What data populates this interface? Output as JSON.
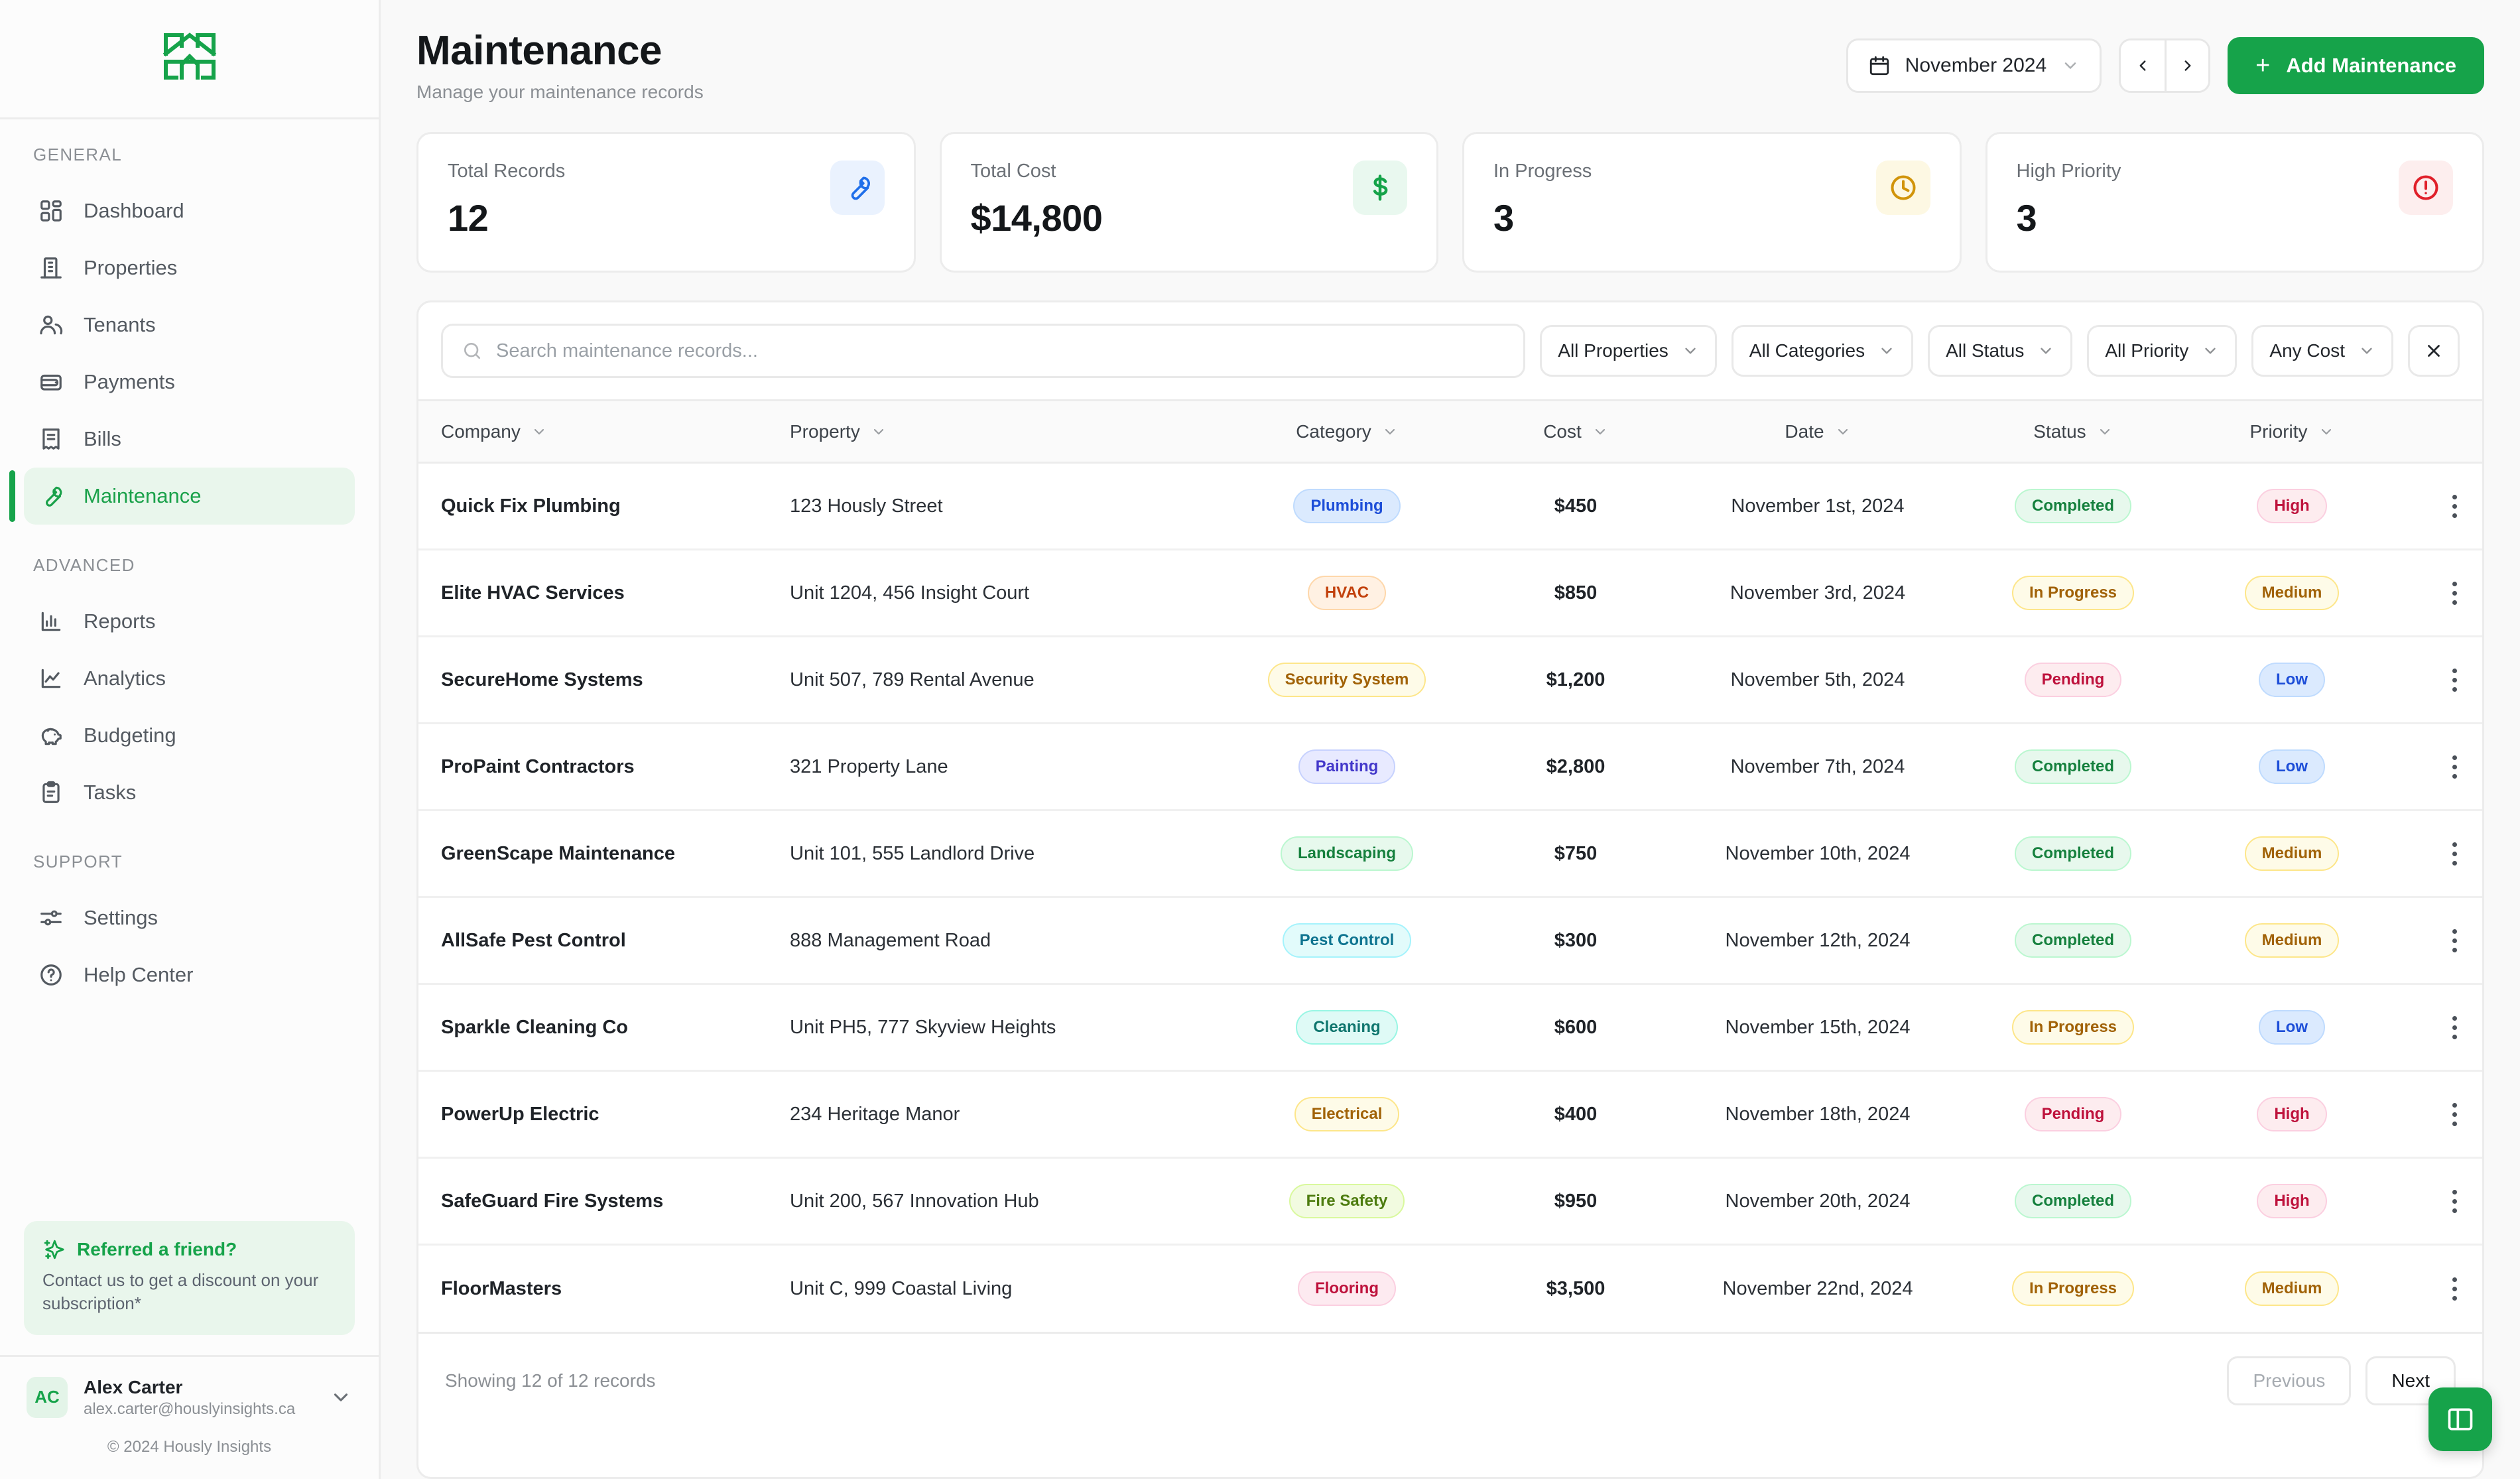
{
  "brand": {
    "logo_icon": "house-logo-icon",
    "accent": "#16a34a",
    "copyright": "© 2024 Hously Insights"
  },
  "sidebar": {
    "sections": [
      {
        "label": "GENERAL",
        "items": [
          {
            "label": "Dashboard",
            "icon": "grid-icon",
            "active": false
          },
          {
            "label": "Properties",
            "icon": "building-icon",
            "active": false
          },
          {
            "label": "Tenants",
            "icon": "users-icon",
            "active": false
          },
          {
            "label": "Payments",
            "icon": "wallet-icon",
            "active": false
          },
          {
            "label": "Bills",
            "icon": "receipt-icon",
            "active": false
          },
          {
            "label": "Maintenance",
            "icon": "wrench-icon",
            "active": true
          }
        ]
      },
      {
        "label": "ADVANCED",
        "items": [
          {
            "label": "Reports",
            "icon": "bar-chart-icon",
            "active": false
          },
          {
            "label": "Analytics",
            "icon": "line-chart-icon",
            "active": false
          },
          {
            "label": "Budgeting",
            "icon": "piggy-bank-icon",
            "active": false
          },
          {
            "label": "Tasks",
            "icon": "clipboard-icon",
            "active": false
          }
        ]
      },
      {
        "label": "SUPPORT",
        "items": [
          {
            "label": "Settings",
            "icon": "sliders-icon",
            "active": false
          },
          {
            "label": "Help Center",
            "icon": "question-mark-icon",
            "active": false
          }
        ]
      }
    ],
    "referral": {
      "icon": "sparkle-icon",
      "title": "Referred a friend?",
      "body": "Contact us to get a discount on your subscription*"
    },
    "user": {
      "initials": "AC",
      "name": "Alex Carter",
      "email": "alex.carter@houslyinsights.ca",
      "chevron_icon": "chevron-down-icon"
    }
  },
  "header": {
    "title": "Maintenance",
    "subtitle": "Manage your maintenance records",
    "month_selector": {
      "icon": "calendar-icon",
      "value": "November 2024",
      "chevron_icon": "chevron-down-icon"
    },
    "prev_icon": "chevron-left-icon",
    "next_icon": "chevron-right-icon",
    "add_button": {
      "plus": "+",
      "label": "Add Maintenance"
    }
  },
  "stats": [
    {
      "label": "Total Records",
      "value": "12",
      "icon": "wrench-icon",
      "icon_bg": "#eaf2fe",
      "icon_color": "#1f6fea"
    },
    {
      "label": "Total Cost",
      "value": "$14,800",
      "icon": "dollar-icon",
      "icon_bg": "#e9f8ef",
      "icon_color": "#15a349"
    },
    {
      "label": "In Progress",
      "value": "3",
      "icon": "clock-icon",
      "icon_bg": "#fdf8e3",
      "icon_color": "#d1940a"
    },
    {
      "label": "High Priority",
      "value": "3",
      "icon": "alert-circle-icon",
      "icon_bg": "#fdeeee",
      "icon_color": "#e0202a"
    }
  ],
  "toolbar": {
    "search": {
      "icon": "search-icon",
      "value": "",
      "placeholder": "Search maintenance records..."
    },
    "filters": [
      {
        "label": "All Properties",
        "icon": "chevron-down-icon"
      },
      {
        "label": "All Categories",
        "icon": "chevron-down-icon"
      },
      {
        "label": "All Status",
        "icon": "chevron-down-icon"
      },
      {
        "label": "All Priority",
        "icon": "chevron-down-icon"
      },
      {
        "label": "Any Cost",
        "icon": "chevron-down-icon"
      }
    ],
    "clear_icon": "close-icon"
  },
  "table": {
    "columns": [
      {
        "label": "Company",
        "sort_icon": "chevron-down-icon",
        "align": "left"
      },
      {
        "label": "Property",
        "sort_icon": "chevron-down-icon",
        "align": "left"
      },
      {
        "label": "Category",
        "sort_icon": "chevron-down-icon",
        "align": "center"
      },
      {
        "label": "Cost",
        "sort_icon": "chevron-down-icon",
        "align": "center"
      },
      {
        "label": "Date",
        "sort_icon": "chevron-down-icon",
        "align": "center"
      },
      {
        "label": "Status",
        "sort_icon": "chevron-down-icon",
        "align": "center"
      },
      {
        "label": "Priority",
        "sort_icon": "chevron-down-icon",
        "align": "center"
      },
      {
        "label": "",
        "sort_icon": "",
        "align": "center"
      }
    ],
    "rows": [
      {
        "company": "Quick Fix Plumbing",
        "property": "123 Hously Street",
        "category": "Plumbing",
        "cost": "$450",
        "date": "November 1st, 2024",
        "status": "Completed",
        "priority": "High",
        "menu_icon": "kebab-menu-icon"
      },
      {
        "company": "Elite HVAC Services",
        "property": "Unit 1204, 456 Insight Court",
        "category": "HVAC",
        "cost": "$850",
        "date": "November 3rd, 2024",
        "status": "In Progress",
        "priority": "Medium",
        "menu_icon": "kebab-menu-icon"
      },
      {
        "company": "SecureHome Systems",
        "property": "Unit 507, 789 Rental Avenue",
        "category": "Security System",
        "cost": "$1,200",
        "date": "November 5th, 2024",
        "status": "Pending",
        "priority": "Low",
        "menu_icon": "kebab-menu-icon"
      },
      {
        "company": "ProPaint Contractors",
        "property": "321 Property Lane",
        "category": "Painting",
        "cost": "$2,800",
        "date": "November 7th, 2024",
        "status": "Completed",
        "priority": "Low",
        "menu_icon": "kebab-menu-icon"
      },
      {
        "company": "GreenScape Maintenance",
        "property": "Unit 101, 555 Landlord Drive",
        "category": "Landscaping",
        "cost": "$750",
        "date": "November 10th, 2024",
        "status": "Completed",
        "priority": "Medium",
        "menu_icon": "kebab-menu-icon"
      },
      {
        "company": "AllSafe Pest Control",
        "property": "888 Management Road",
        "category": "Pest Control",
        "cost": "$300",
        "date": "November 12th, 2024",
        "status": "Completed",
        "priority": "Medium",
        "menu_icon": "kebab-menu-icon"
      },
      {
        "company": "Sparkle Cleaning Co",
        "property": "Unit PH5, 777 Skyview Heights",
        "category": "Cleaning",
        "cost": "$600",
        "date": "November 15th, 2024",
        "status": "In Progress",
        "priority": "Low",
        "menu_icon": "kebab-menu-icon"
      },
      {
        "company": "PowerUp Electric",
        "property": "234 Heritage Manor",
        "category": "Electrical",
        "cost": "$400",
        "date": "November 18th, 2024",
        "status": "Pending",
        "priority": "High",
        "menu_icon": "kebab-menu-icon"
      },
      {
        "company": "SafeGuard Fire Systems",
        "property": "Unit 200, 567 Innovation Hub",
        "category": "Fire Safety",
        "cost": "$950",
        "date": "November 20th, 2024",
        "status": "Completed",
        "priority": "High",
        "menu_icon": "kebab-menu-icon"
      },
      {
        "company": "FloorMasters",
        "property": "Unit C, 999 Coastal Living",
        "category": "Flooring",
        "cost": "$3,500",
        "date": "November 22nd, 2024",
        "status": "In Progress",
        "priority": "Medium",
        "menu_icon": "kebab-menu-icon"
      }
    ],
    "category_colors": {
      "Plumbing": {
        "bg": "#dbeafe",
        "fg": "#1d4ed8",
        "bd": "#bfdbfe"
      },
      "HVAC": {
        "bg": "#fff1e3",
        "fg": "#c2410c",
        "bd": "#fed7aa"
      },
      "Security System": {
        "bg": "#fefbe8",
        "fg": "#a16207",
        "bd": "#fde68a"
      },
      "Painting": {
        "bg": "#e8eaff",
        "fg": "#4338ca",
        "bd": "#c7d2fe"
      },
      "Landscaping": {
        "bg": "#e7f9ed",
        "fg": "#15803d",
        "bd": "#bbf7d0"
      },
      "Pest Control": {
        "bg": "#e2fbfb",
        "fg": "#0e7490",
        "bd": "#a5f3fc"
      },
      "Cleaning": {
        "bg": "#dffaf6",
        "fg": "#0f766e",
        "bd": "#99f6e4"
      },
      "Electrical": {
        "bg": "#fefbe8",
        "fg": "#a16207",
        "bd": "#fde68a"
      },
      "Fire Safety": {
        "bg": "#f2fbe0",
        "fg": "#4d7c0f",
        "bd": "#d9f99d"
      },
      "Flooring": {
        "bg": "#fdeaf0",
        "fg": "#be123c",
        "bd": "#fbcfe0"
      }
    },
    "status_colors": {
      "Completed": {
        "bg": "#e7f8ed",
        "fg": "#15803d",
        "bd": "#bbf7d0"
      },
      "In Progress": {
        "bg": "#fefbe8",
        "fg": "#a16207",
        "bd": "#fde68a"
      },
      "Pending": {
        "bg": "#fdecef",
        "fg": "#be123c",
        "bd": "#fbcfe0"
      }
    },
    "priority_colors": {
      "High": {
        "bg": "#fdecef",
        "fg": "#be123c",
        "bd": "#fbcfe0"
      },
      "Medium": {
        "bg": "#fefbe8",
        "fg": "#a16207",
        "bd": "#fde68a"
      },
      "Low": {
        "bg": "#dbeafe",
        "fg": "#1d4ed8",
        "bd": "#bfdbfe"
      }
    }
  },
  "footer": {
    "records_text": "Showing 12 of 12 records",
    "previous_label": "Previous",
    "next_label": "Next"
  },
  "fab": {
    "icon": "panel-toggle-icon"
  }
}
